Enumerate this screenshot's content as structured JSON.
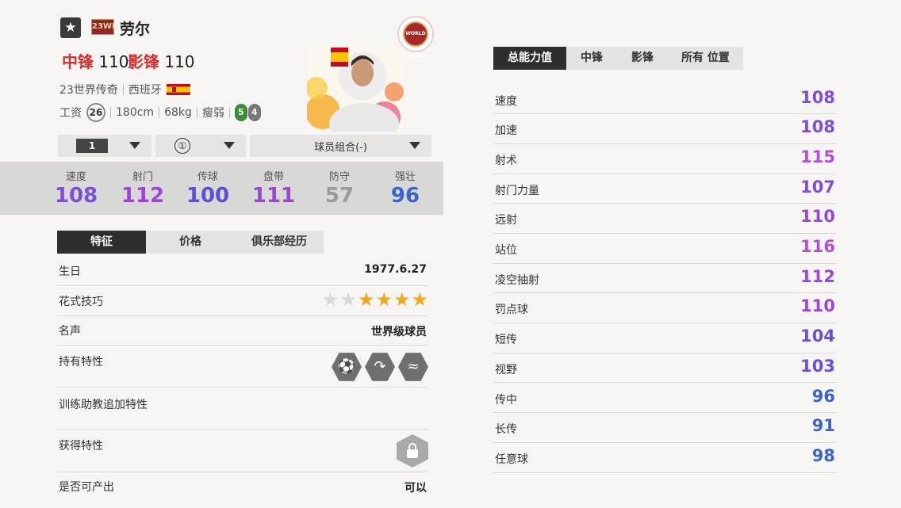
{
  "header": {
    "grade_icon": "star-icon",
    "season_tag": "23WL",
    "player_name": "劳尔",
    "positions": [
      {
        "name": "中锋",
        "value": "110"
      },
      {
        "name": "影锋",
        "value": "110"
      }
    ],
    "season_name": "23世界传奇",
    "nationality": "西班牙",
    "wage_label": "工资",
    "wage": "26",
    "height": "180cm",
    "weight": "68kg",
    "body_type": "瘦弱",
    "weak_foot": "5",
    "strong_foot": "4",
    "badge_text": "WORLD LEGEND"
  },
  "selectors": {
    "level": "1",
    "grade": "①",
    "team_combo": "球员组合(-)"
  },
  "main_stats": [
    {
      "label": "速度",
      "value": "108",
      "color": "#7b4fd6"
    },
    {
      "label": "射门",
      "value": "112",
      "color": "#9a46d6"
    },
    {
      "label": "传球",
      "value": "100",
      "color": "#5a4fd6"
    },
    {
      "label": "盘带",
      "value": "111",
      "color": "#9a46d6"
    },
    {
      "label": "防守",
      "value": "57",
      "color": "#9a9a9a"
    },
    {
      "label": "强壮",
      "value": "96",
      "color": "#3b63c9"
    }
  ],
  "detail_tabs": [
    "特征",
    "价格",
    "俱乐部经历"
  ],
  "details": {
    "birthday_label": "生日",
    "birthday": "1977.6.27",
    "skill_moves_label": "花式技巧",
    "skill_moves": 4,
    "skill_moves_max": 6,
    "reputation_label": "名声",
    "reputation": "世界级球员",
    "traits_label": "持有特性",
    "traits_icons": [
      "long-shot-trait-icon",
      "finesse-trait-icon",
      "dribble-trait-icon"
    ],
    "coach_traits_label": "训练助教追加特性",
    "acquired_traits_label": "获得特性",
    "acquired_icon": "lock-icon",
    "producible_label": "是否可产出",
    "producible": "可以"
  },
  "ability_tabs": [
    "总能力值",
    "中锋",
    "影锋",
    "所有 位置"
  ],
  "abilities": [
    {
      "label": "速度",
      "value": "108",
      "color": "#7b4fd6"
    },
    {
      "label": "加速",
      "value": "108",
      "color": "#7b4fd6"
    },
    {
      "label": "射术",
      "value": "115",
      "color": "#b34fd6"
    },
    {
      "label": "射门力量",
      "value": "107",
      "color": "#7b4fd6"
    },
    {
      "label": "远射",
      "value": "110",
      "color": "#9a46d6"
    },
    {
      "label": "站位",
      "value": "116",
      "color": "#b34fd6"
    },
    {
      "label": "凌空抽射",
      "value": "112",
      "color": "#9a46d6"
    },
    {
      "label": "罚点球",
      "value": "110",
      "color": "#9a46d6"
    },
    {
      "label": "短传",
      "value": "104",
      "color": "#6a4fd6"
    },
    {
      "label": "视野",
      "value": "103",
      "color": "#6a4fd6"
    },
    {
      "label": "传中",
      "value": "96",
      "color": "#3b63c9"
    },
    {
      "label": "长传",
      "value": "91",
      "color": "#3b63c9"
    },
    {
      "label": "任意球",
      "value": "98",
      "color": "#3b63c9"
    }
  ]
}
